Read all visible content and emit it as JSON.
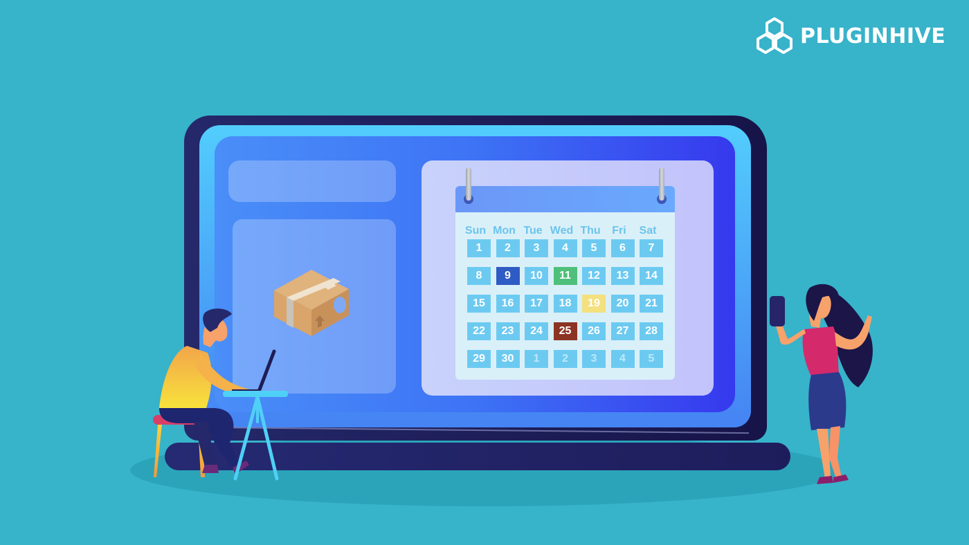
{
  "brand": {
    "name": "PLUGINHIVE",
    "logo_icon": "hexagon-cluster-icon"
  },
  "colors": {
    "background": "#37b3ca",
    "laptop_bezel": "#1e1d5b",
    "screen": "#3d73f5",
    "cell_default": "#6ccaf1",
    "cell_blue": "#2f5bc4",
    "cell_green": "#4fc07a",
    "cell_yellow": "#f4e07f",
    "cell_red": "#8b3424"
  },
  "screen": {
    "package_icon": "package-box-icon"
  },
  "calendar": {
    "day_names": [
      "Sun",
      "Mon",
      "Tue",
      "Wed",
      "Thu",
      "Fri",
      "Sat"
    ],
    "weeks": [
      [
        {
          "d": "1"
        },
        {
          "d": "2"
        },
        {
          "d": "3"
        },
        {
          "d": "4"
        },
        {
          "d": "5"
        },
        {
          "d": "6"
        },
        {
          "d": "7"
        }
      ],
      [
        {
          "d": "8"
        },
        {
          "d": "9",
          "hl": "blue"
        },
        {
          "d": "10"
        },
        {
          "d": "11",
          "hl": "green"
        },
        {
          "d": "12"
        },
        {
          "d": "13"
        },
        {
          "d": "14"
        }
      ],
      [
        {
          "d": "15"
        },
        {
          "d": "16"
        },
        {
          "d": "17"
        },
        {
          "d": "18"
        },
        {
          "d": "19",
          "hl": "yellow"
        },
        {
          "d": "20"
        },
        {
          "d": "21"
        }
      ],
      [
        {
          "d": "22"
        },
        {
          "d": "23"
        },
        {
          "d": "24"
        },
        {
          "d": "25",
          "hl": "red"
        },
        {
          "d": "26"
        },
        {
          "d": "27"
        },
        {
          "d": "28"
        }
      ],
      [
        {
          "d": "29"
        },
        {
          "d": "30"
        },
        {
          "d": "1",
          "other": true
        },
        {
          "d": "2",
          "other": true
        },
        {
          "d": "3",
          "other": true
        },
        {
          "d": "4",
          "other": true
        },
        {
          "d": "5",
          "other": true
        }
      ]
    ]
  },
  "illustrations": {
    "left_person": "man-using-laptop-illustration",
    "right_person": "woman-holding-phone-illustration"
  }
}
